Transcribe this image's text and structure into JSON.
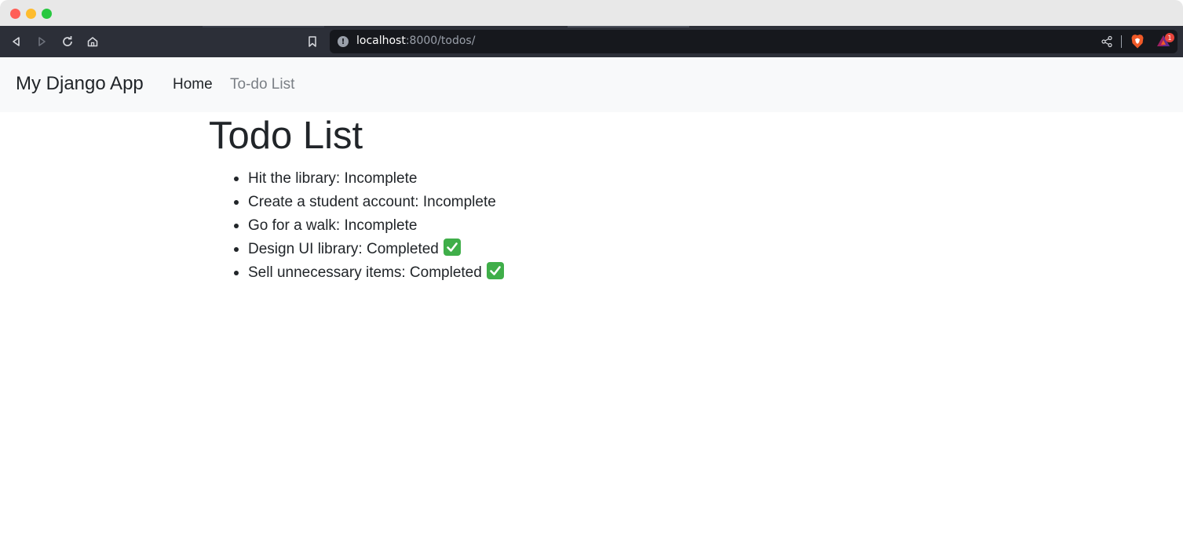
{
  "browser": {
    "url_host": "localhost",
    "url_path": ":8000/todos/",
    "rewards_count": "1",
    "icons": [
      "back-icon",
      "forward-icon",
      "reload-icon",
      "home-icon",
      "bookmark-icon",
      "site-info-icon",
      "share-icon",
      "brave-shield-icon",
      "brave-rewards-icon"
    ]
  },
  "navbar": {
    "brand": "My Django App",
    "links": [
      {
        "label": "Home"
      },
      {
        "label": "To-do List"
      }
    ]
  },
  "main": {
    "title": "Todo List",
    "todos": [
      {
        "text": "Hit the library: Incomplete",
        "completed": false
      },
      {
        "text": "Create a student account: Incomplete",
        "completed": false
      },
      {
        "text": "Go for a walk: Incomplete",
        "completed": false
      },
      {
        "text": "Design UI library: Completed",
        "completed": true
      },
      {
        "text": "Sell unnecessary items: Completed",
        "completed": true
      }
    ]
  },
  "colors": {
    "navbar_bg": "#f8f9fa",
    "text": "#212529",
    "muted_link": "#7a7f85",
    "check_green": "#3fae49"
  }
}
